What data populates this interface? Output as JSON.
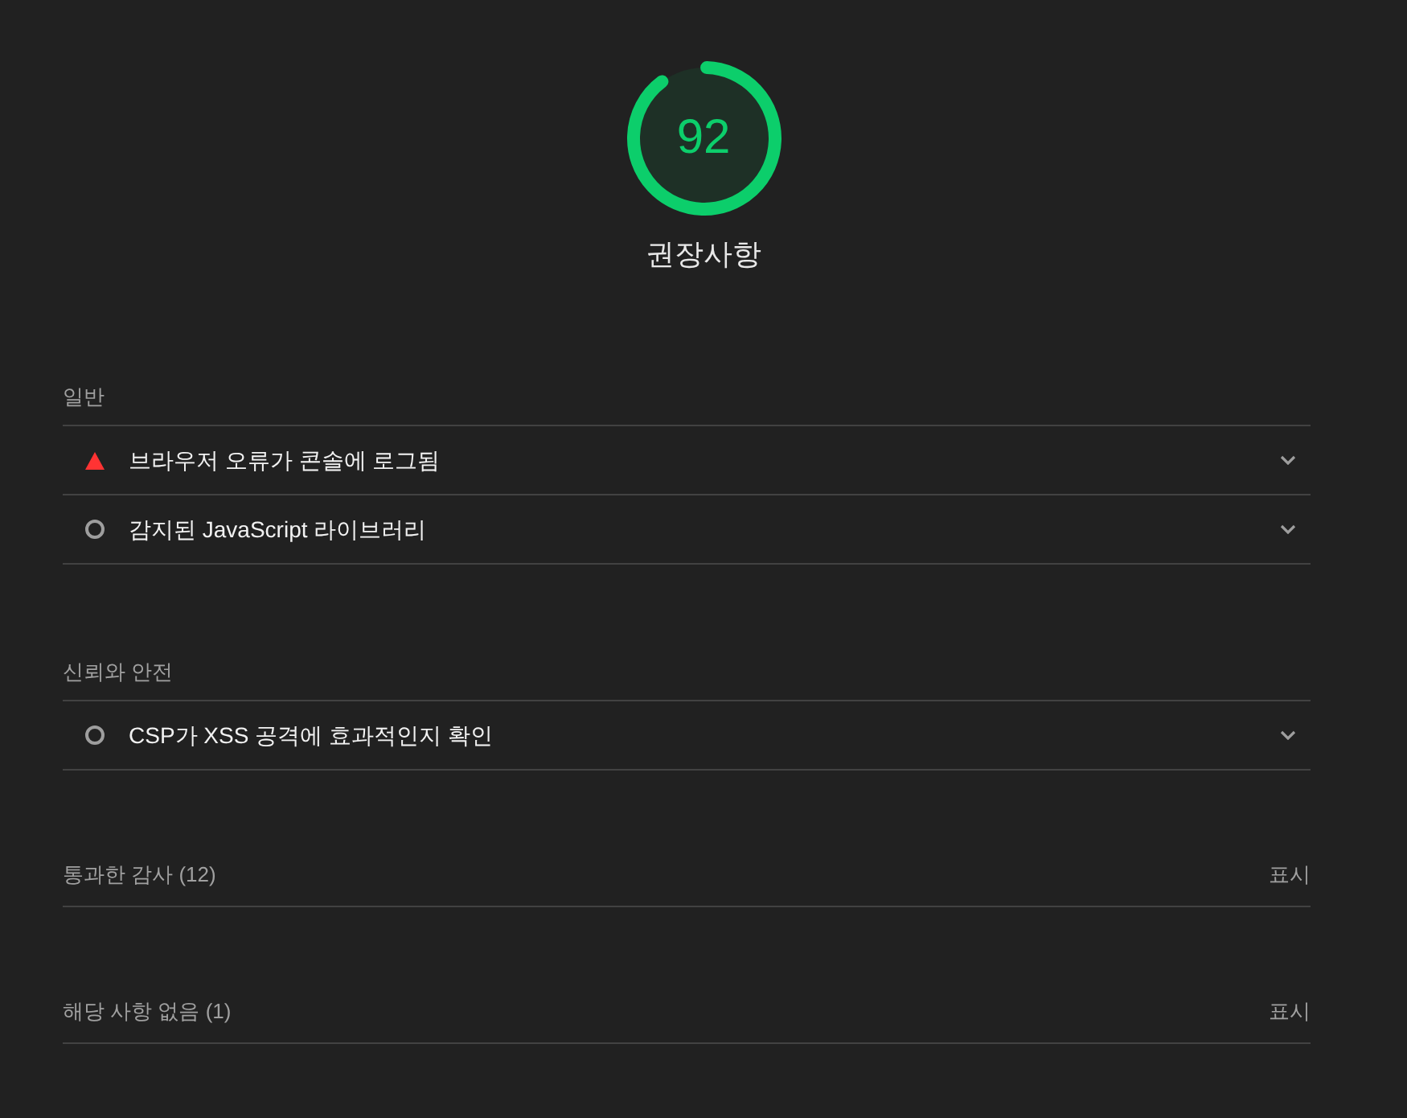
{
  "gauge": {
    "score": "92",
    "level": 0.92
  },
  "category_title": "권장사항",
  "groups": [
    {
      "title": "일반",
      "audits": [
        {
          "kind": "fail",
          "title": "브라우저 오류가 콘솔에 로그됨",
          "expanded": false
        },
        {
          "kind": "informative",
          "title": "감지된 JavaScript 라이브러리",
          "expanded": false
        }
      ]
    },
    {
      "title": "신뢰와 안전",
      "audits": [
        {
          "kind": "informative",
          "title": "CSP가 XSS 공격에 효과적인지 확인",
          "expanded": false
        }
      ]
    }
  ],
  "collapsed_groups": [
    {
      "title": "통과한 감사 (12)",
      "toggle": "표시"
    },
    {
      "title": "해당 사항 없음 (1)",
      "toggle": "표시"
    }
  ]
}
